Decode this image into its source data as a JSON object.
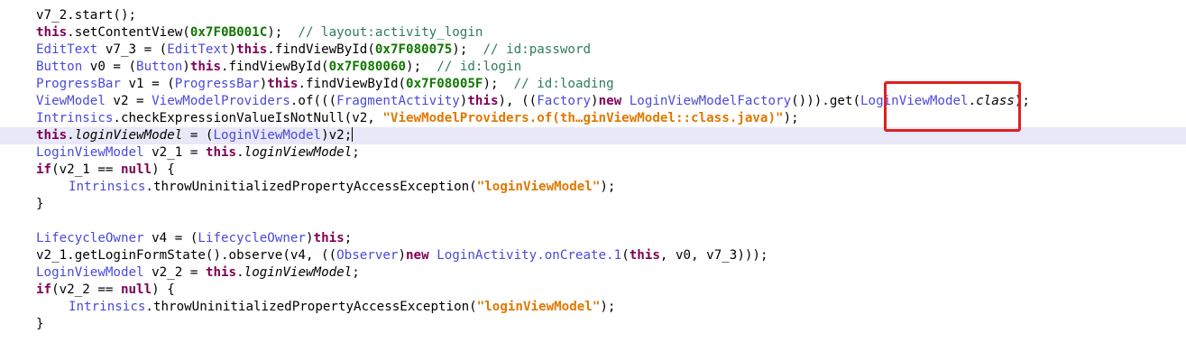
{
  "editor": {
    "lines": [
      [
        {
          "t": "v7_2.start();",
          "c": "plain"
        }
      ],
      [
        {
          "t": "this",
          "c": "kw"
        },
        {
          "t": ".setContentView(",
          "c": "plain"
        },
        {
          "t": "0x7F0B001C",
          "c": "num"
        },
        {
          "t": ");  ",
          "c": "plain"
        },
        {
          "t": "// layout:activity_login",
          "c": "cm"
        }
      ],
      [
        {
          "t": "EditText",
          "c": "type"
        },
        {
          "t": " v7_3 = (",
          "c": "plain"
        },
        {
          "t": "EditText",
          "c": "type"
        },
        {
          "t": ")",
          "c": "plain"
        },
        {
          "t": "this",
          "c": "kw"
        },
        {
          "t": ".findViewById(",
          "c": "plain"
        },
        {
          "t": "0x7F080075",
          "c": "num"
        },
        {
          "t": ");  ",
          "c": "plain"
        },
        {
          "t": "// id:password",
          "c": "cm"
        }
      ],
      [
        {
          "t": "Button",
          "c": "type"
        },
        {
          "t": " v0 = (",
          "c": "plain"
        },
        {
          "t": "Button",
          "c": "type"
        },
        {
          "t": ")",
          "c": "plain"
        },
        {
          "t": "this",
          "c": "kw"
        },
        {
          "t": ".findViewById(",
          "c": "plain"
        },
        {
          "t": "0x7F080060",
          "c": "num"
        },
        {
          "t": ");  ",
          "c": "plain"
        },
        {
          "t": "// id:login",
          "c": "cm"
        }
      ],
      [
        {
          "t": "ProgressBar",
          "c": "type"
        },
        {
          "t": " v1 = (",
          "c": "plain"
        },
        {
          "t": "ProgressBar",
          "c": "type"
        },
        {
          "t": ")",
          "c": "plain"
        },
        {
          "t": "this",
          "c": "kw"
        },
        {
          "t": ".findViewById(",
          "c": "plain"
        },
        {
          "t": "0x7F08005F",
          "c": "num"
        },
        {
          "t": ");  ",
          "c": "plain"
        },
        {
          "t": "// id:loading",
          "c": "cm"
        }
      ],
      [
        {
          "t": "ViewModel",
          "c": "type"
        },
        {
          "t": " v2 = ",
          "c": "plain"
        },
        {
          "t": "ViewModelProviders",
          "c": "type"
        },
        {
          "t": ".of(((",
          "c": "plain"
        },
        {
          "t": "FragmentActivity",
          "c": "type"
        },
        {
          "t": ")",
          "c": "plain"
        },
        {
          "t": "this",
          "c": "kw"
        },
        {
          "t": "), ((",
          "c": "plain"
        },
        {
          "t": "Factory",
          "c": "type"
        },
        {
          "t": ")",
          "c": "plain"
        },
        {
          "t": "new",
          "c": "kw"
        },
        {
          "t": " ",
          "c": "plain"
        },
        {
          "t": "LoginViewModelFactory",
          "c": "type"
        },
        {
          "t": "())).get(",
          "c": "plain"
        },
        {
          "t": "LoginViewModel",
          "c": "type"
        },
        {
          "t": ".",
          "c": "plain"
        },
        {
          "t": "class",
          "c": "it"
        },
        {
          "t": ");",
          "c": "plain"
        }
      ],
      [
        {
          "t": "Intrinsics",
          "c": "type"
        },
        {
          "t": ".checkExpressionValueIsNotNull(v2, ",
          "c": "plain"
        },
        {
          "t": "\"ViewModelProviders.of(th…ginViewModel::class.java)\"",
          "c": "str"
        },
        {
          "t": ");",
          "c": "plain"
        }
      ],
      [
        {
          "t": "this",
          "c": "kw"
        },
        {
          "t": ".",
          "c": "plain"
        },
        {
          "t": "loginViewModel",
          "c": "it"
        },
        {
          "t": " = (",
          "c": "plain"
        },
        {
          "t": "LoginViewModel",
          "c": "type"
        },
        {
          "t": ")v2;",
          "c": "plain"
        }
      ],
      [
        {
          "t": "LoginViewModel",
          "c": "type"
        },
        {
          "t": " v2_1 = ",
          "c": "plain"
        },
        {
          "t": "this",
          "c": "kw"
        },
        {
          "t": ".",
          "c": "plain"
        },
        {
          "t": "loginViewModel",
          "c": "it"
        },
        {
          "t": ";",
          "c": "plain"
        }
      ],
      [
        {
          "t": "if",
          "c": "kw"
        },
        {
          "t": "(v2_1 == ",
          "c": "plain"
        },
        {
          "t": "null",
          "c": "kw"
        },
        {
          "t": ") {",
          "c": "plain"
        }
      ],
      [
        {
          "t": "Intrinsics",
          "c": "type"
        },
        {
          "t": ".throwUninitializedPropertyAccessException(",
          "c": "plain"
        },
        {
          "t": "\"loginViewModel\"",
          "c": "str"
        },
        {
          "t": ");",
          "c": "plain"
        }
      ],
      [
        {
          "t": "}",
          "c": "plain"
        }
      ],
      [],
      [
        {
          "t": "LifecycleOwner",
          "c": "type"
        },
        {
          "t": " v4 = (",
          "c": "plain"
        },
        {
          "t": "LifecycleOwner",
          "c": "type"
        },
        {
          "t": ")",
          "c": "plain"
        },
        {
          "t": "this",
          "c": "kw"
        },
        {
          "t": ";",
          "c": "plain"
        }
      ],
      [
        {
          "t": "v2_1.getLoginFormState().observe(v4, ((",
          "c": "plain"
        },
        {
          "t": "Observer",
          "c": "type"
        },
        {
          "t": ")",
          "c": "plain"
        },
        {
          "t": "new",
          "c": "kw"
        },
        {
          "t": " ",
          "c": "plain"
        },
        {
          "t": "LoginActivity.onCreate.1",
          "c": "type"
        },
        {
          "t": "(",
          "c": "plain"
        },
        {
          "t": "this",
          "c": "kw"
        },
        {
          "t": ", v0, v7_3)));",
          "c": "plain"
        }
      ],
      [
        {
          "t": "LoginViewModel",
          "c": "type"
        },
        {
          "t": " v2_2 = ",
          "c": "plain"
        },
        {
          "t": "this",
          "c": "kw"
        },
        {
          "t": ".",
          "c": "plain"
        },
        {
          "t": "loginViewModel",
          "c": "it"
        },
        {
          "t": ";",
          "c": "plain"
        }
      ],
      [
        {
          "t": "if",
          "c": "kw"
        },
        {
          "t": "(v2_2 == ",
          "c": "plain"
        },
        {
          "t": "null",
          "c": "kw"
        },
        {
          "t": ") {",
          "c": "plain"
        }
      ],
      [
        {
          "t": "Intrinsics",
          "c": "type"
        },
        {
          "t": ".throwUninitializedPropertyAccessException(",
          "c": "plain"
        },
        {
          "t": "\"loginViewModel\"",
          "c": "str"
        },
        {
          "t": ");",
          "c": "plain"
        }
      ],
      [
        {
          "t": "}",
          "c": "plain"
        }
      ]
    ],
    "current_line": 7,
    "indented_lines": [
      10,
      17
    ]
  },
  "colors": {
    "keyword": "#7f0055",
    "type": "#4a4adb",
    "number": "#117700",
    "string": "#e07800",
    "comment": "#2e7d5b",
    "current_line_bg": "#e8e8f8",
    "highlight_box": "#e02020"
  }
}
